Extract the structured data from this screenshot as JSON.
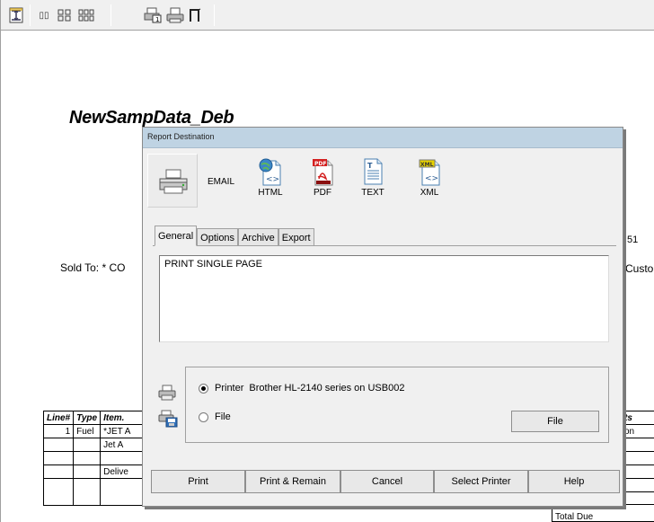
{
  "report": {
    "title": "NewSampData_Deb",
    "sold_to": "Sold To:  * CO",
    "right_fragments": [
      "51",
      "Custor"
    ],
    "table": {
      "headers": [
        "Line#",
        "Type",
        "Item."
      ],
      "right_header": "ts",
      "rows": [
        {
          "line": "1",
          "type": "Fuel",
          "item": "*JET A"
        },
        {
          "line": "",
          "type": "",
          "item": "Jet A"
        },
        {
          "line": "",
          "type": "",
          "item": ""
        },
        {
          "line": "",
          "type": "",
          "item": "Delive"
        },
        {
          "line": "",
          "type": "",
          "item": ""
        }
      ],
      "right_cells": [
        "on",
        "",
        "",
        "",
        ""
      ],
      "total_due": "Total Due"
    }
  },
  "dialog": {
    "title": "Report Destination",
    "destinations": [
      {
        "label": "EMAIL",
        "icon": "email-icon"
      },
      {
        "label": "HTML",
        "icon": "html-icon"
      },
      {
        "label": "PDF",
        "icon": "pdf-icon"
      },
      {
        "label": "TEXT",
        "icon": "text-icon"
      },
      {
        "label": "XML",
        "icon": "xml-icon"
      }
    ],
    "tabs": [
      "General",
      "Options",
      "Archive",
      "Export"
    ],
    "active_tab": "General",
    "text_value": "PRINT SINGLE PAGE",
    "printer_label": "Printer",
    "printer_name": "Brother HL-2140 series on USB002",
    "file_label": "File",
    "file_button": "File",
    "buttons": [
      "Print",
      "Print & Remain",
      "Cancel",
      "Select Printer",
      "Help"
    ]
  }
}
